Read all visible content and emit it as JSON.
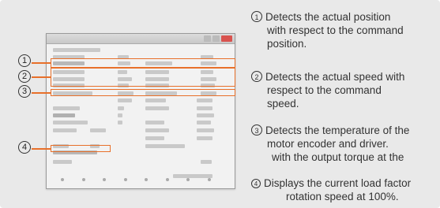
{
  "descriptions": [
    {
      "num": "1",
      "lines": [
        "Detects the actual position",
        "with respect to the command",
        "position."
      ]
    },
    {
      "num": "2",
      "lines": [
        "Detects the actual speed with",
        "respect to the command",
        "speed."
      ]
    },
    {
      "num": "3",
      "lines": [
        "Detects the temperature of the",
        "motor encoder and driver."
      ]
    },
    {
      "num": "4",
      "lines": [
        "Displays the current load factor"
      ]
    }
  ],
  "overlap_text_a": "with the output torque at the",
  "overlap_text_b": "rotation speed at 100%.",
  "callouts": [
    "1",
    "2",
    "3",
    "4"
  ],
  "accent_color": "#e8702a"
}
